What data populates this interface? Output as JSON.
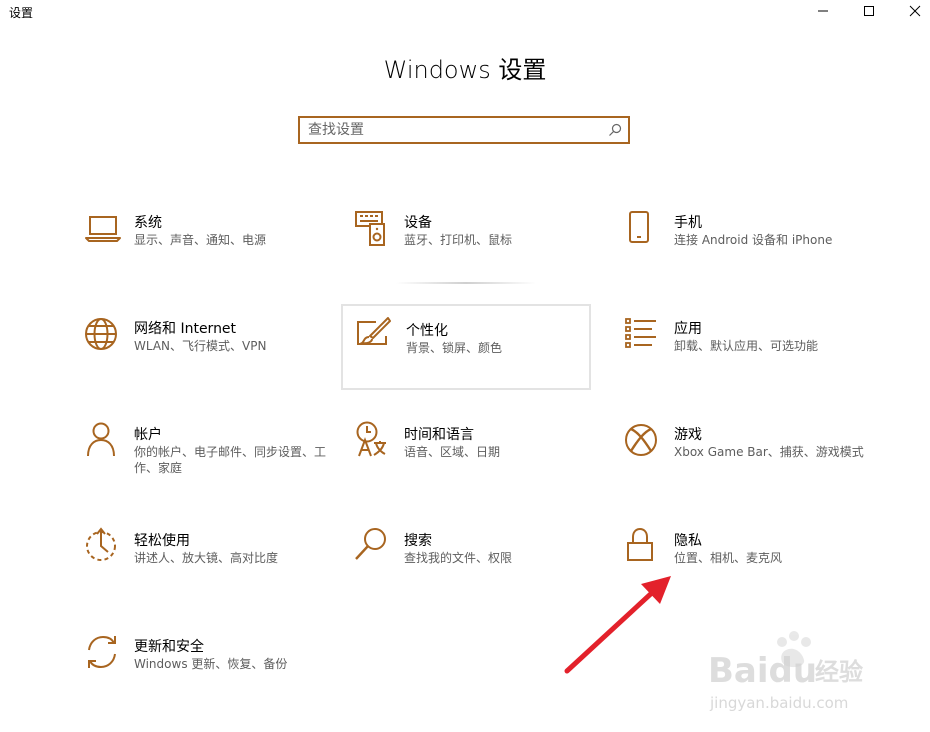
{
  "window": {
    "title": "设置"
  },
  "page": {
    "title": "Windows 设置"
  },
  "search": {
    "placeholder": "查找设置"
  },
  "colors": {
    "accent": "#a86520",
    "annotation_arrow": "#e3212b"
  },
  "tiles": [
    {
      "name": "系统",
      "desc": "显示、声音、通知、电源",
      "icon": "laptop-icon"
    },
    {
      "name": "设备",
      "desc": "蓝牙、打印机、鼠标",
      "icon": "devices-icon"
    },
    {
      "name": "手机",
      "desc": "连接 Android 设备和 iPhone",
      "icon": "phone-icon"
    },
    {
      "name": "网络和 Internet",
      "desc": "WLAN、飞行模式、VPN",
      "icon": "globe-icon"
    },
    {
      "name": "个性化",
      "desc": "背景、锁屏、颜色",
      "icon": "paint-icon"
    },
    {
      "name": "应用",
      "desc": "卸载、默认应用、可选功能",
      "icon": "apps-list-icon"
    },
    {
      "name": "帐户",
      "desc": "你的帐户、电子邮件、同步设置、工作、家庭",
      "icon": "person-icon"
    },
    {
      "name": "时间和语言",
      "desc": "语音、区域、日期",
      "icon": "time-language-icon"
    },
    {
      "name": "游戏",
      "desc": "Xbox Game Bar、捕获、游戏模式",
      "icon": "xbox-icon"
    },
    {
      "name": "轻松使用",
      "desc": "讲述人、放大镜、高对比度",
      "icon": "ease-of-access-icon"
    },
    {
      "name": "搜索",
      "desc": "查找我的文件、权限",
      "icon": "search-icon"
    },
    {
      "name": "隐私",
      "desc": "位置、相机、麦克风",
      "icon": "lock-icon"
    },
    {
      "name": "更新和安全",
      "desc": "Windows 更新、恢复、备份",
      "icon": "sync-icon"
    }
  ],
  "watermark": {
    "brand": "Baidu",
    "brand_cn": "经验",
    "url": "jingyan.baidu.com"
  }
}
